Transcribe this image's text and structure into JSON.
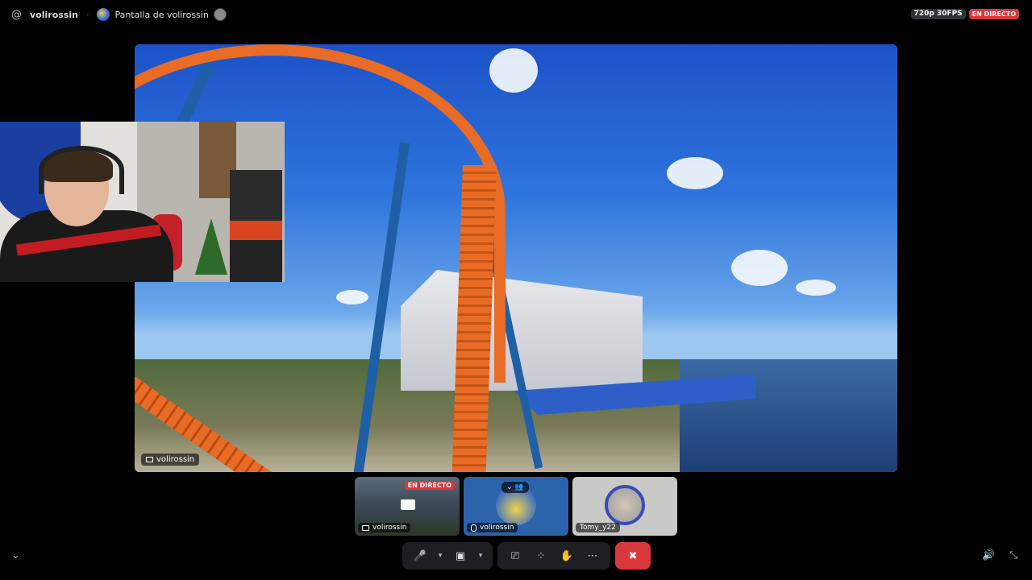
{
  "topbar": {
    "at_symbol": "@",
    "channel": "volirossin",
    "separator": "·",
    "screen_title": "Pantalla de volirossin",
    "quality": "720p 30FPS",
    "live": "EN DIRECTO"
  },
  "stage": {
    "tag": "volirossin",
    "scene": "roller coaster park view"
  },
  "tiles": [
    {
      "label": "volirossin",
      "live": "EN DIRECTO",
      "icon": "screen-share-icon"
    },
    {
      "label": "volirossin",
      "icon": "mic-muted-icon"
    },
    {
      "label": "Tomy_y22",
      "icon": "avatar-icon"
    }
  ],
  "controls": {
    "mic": "🎤",
    "camera": "▣",
    "screen": "⎚",
    "activities": "⁘",
    "soundboard": "✋",
    "more": "⋯",
    "end": "✖",
    "caret": "▾"
  },
  "corners": {
    "collapse": "⌄",
    "volume": "🔊",
    "exit_fullscreen": "⤡"
  },
  "colors": {
    "live_red": "#da373c",
    "bar_bg": "#1e1f22"
  }
}
